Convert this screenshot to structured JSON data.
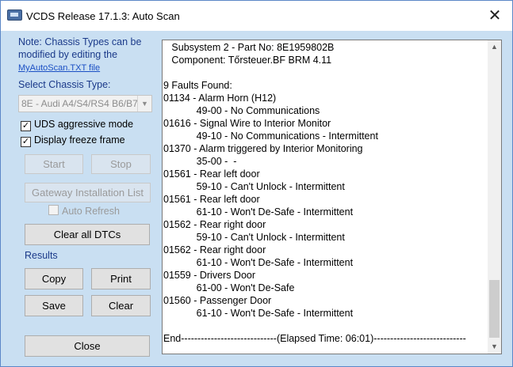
{
  "window": {
    "title": "VCDS Release 17.1.3:  Auto Scan",
    "close_glyph": "✕"
  },
  "left_panel": {
    "note": "Note:  Chassis Types can be modified by editing the",
    "note_link": "MyAutoScan.TXT file",
    "chassis_label": "Select Chassis Type:",
    "chassis_selected": "8E - Audi A4/S4/RS4 B6/B7",
    "checkboxes": {
      "uds_label": "UDS aggressive mode",
      "uds_checked": true,
      "freeze_label": "Display freeze frame",
      "freeze_checked": true,
      "auto_refresh_label": "Auto Refresh",
      "auto_refresh_checked": false
    },
    "buttons": {
      "start": "Start",
      "stop": "Stop",
      "gateway": "Gateway Installation List",
      "clear_all_dtcs": "Clear all DTCs",
      "copy": "Copy",
      "print": "Print",
      "save": "Save",
      "clear": "Clear",
      "close": "Close"
    },
    "results_label": "Results"
  },
  "log": {
    "lines": [
      "   Subsystem 2 - Part No: 8E1959802B",
      "   Component: Tőrsteuer.BF BRM 4.11",
      "",
      "9 Faults Found:",
      "01134 - Alarm Horn (H12)",
      "            49-00 - No Communications",
      "01616 - Signal Wire to Interior Monitor",
      "            49-10 - No Communications - Intermittent",
      "01370 - Alarm triggered by Interior Monitoring",
      "            35-00 -  -",
      "01561 - Rear left door",
      "            59-10 - Can't Unlock - Intermittent",
      "01561 - Rear left door",
      "            61-10 - Won't De-Safe - Intermittent",
      "01562 - Rear right door",
      "            59-10 - Can't Unlock - Intermittent",
      "01562 - Rear right door",
      "            61-10 - Won't De-Safe - Intermittent",
      "01559 - Drivers Door",
      "            61-00 - Won't De-Safe",
      "01560 - Passenger Door",
      "            61-10 - Won't De-Safe - Intermittent",
      "",
      "End-----------------------------(Elapsed Time: 06:01)----------------------------"
    ]
  }
}
